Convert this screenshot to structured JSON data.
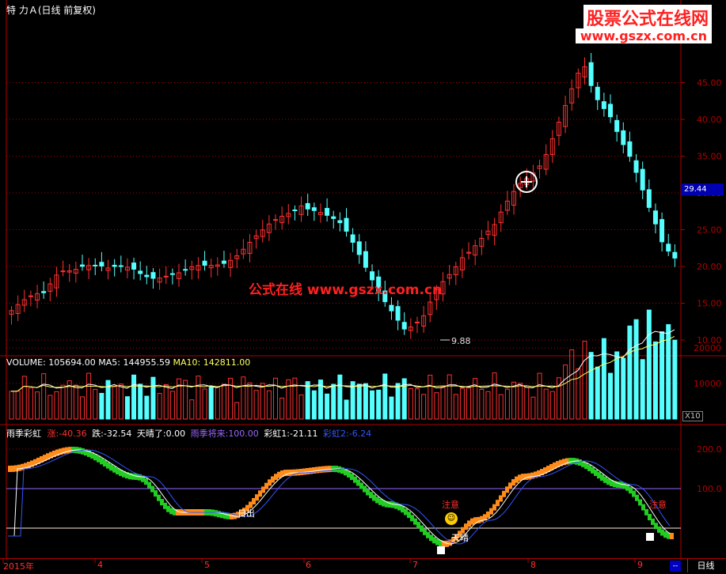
{
  "header": {
    "title": "特 力Ａ(日线 前复权)"
  },
  "watermark": {
    "logo_cn": "股票公式在线网",
    "logo_url": "www.gszx.com.cn",
    "center_text": "公式在线  www.gszx.com.cn"
  },
  "price_panel": {
    "y_ticks": [
      "45.00",
      "40.00",
      "35.00",
      "30.00",
      "25.00",
      "20.00",
      "15.00",
      "10.00"
    ],
    "current_price": "29.44",
    "low_label": "9.88",
    "colors": {
      "up": "#ff3030",
      "down": "#55ffff",
      "grid": "#b00000",
      "axis_text": "#b00000"
    }
  },
  "volume_panel": {
    "label": "VOLUME:",
    "value": "105694.00",
    "ma5_label": "MA5:",
    "ma5_value": "144955.59",
    "ma10_label": "MA10:",
    "ma10_value": "142811.00",
    "y_ticks": [
      "20000",
      "10000"
    ],
    "unit": "X10"
  },
  "indicator_panel": {
    "name": "雨季彩虹",
    "zhang_label": "涨:",
    "zhang_value": "-40.36",
    "die_label": "跌:",
    "die_value": "-32.54",
    "qing_label": "天晴了:",
    "qing_value": "0.00",
    "rain_label": "雨季将来:",
    "rain_value": "100.00",
    "rb1_label": "彩虹1:",
    "rb1_value": "-21.11",
    "rb2_label": "彩虹2:",
    "rb2_value": "-6.24",
    "y_ticks": [
      "200.0",
      "100.0"
    ],
    "annotations": {
      "sunrise": "日出",
      "attention1": "注意",
      "sunny": "天晴",
      "attention2": "注意"
    },
    "colors": {
      "rise": "#ff8c1a",
      "fall": "#22cc22",
      "rain_line": "#9966ff",
      "zero_line": "#ffeedd"
    }
  },
  "x_axis": {
    "labels": [
      "2015年",
      "4",
      "5",
      "6",
      "7",
      "8",
      "9"
    ]
  },
  "period_button": "日线"
}
